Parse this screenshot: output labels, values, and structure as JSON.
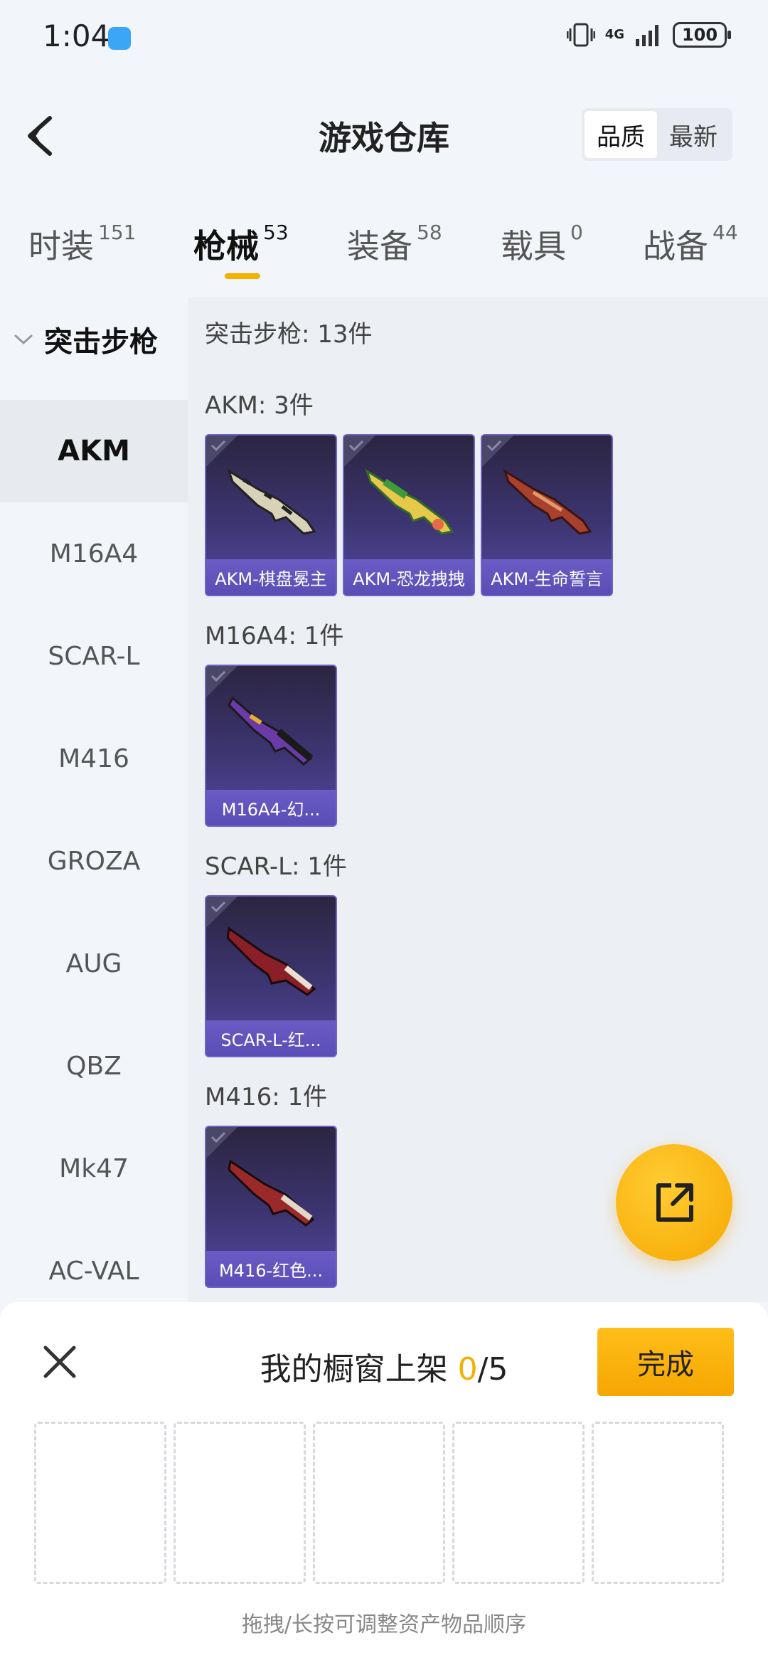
{
  "status": {
    "time": "1:04",
    "network": "4G",
    "battery": "100"
  },
  "header": {
    "title": "游戏仓库",
    "sort_options": [
      "品质",
      "最新"
    ],
    "sort_active": "品质"
  },
  "tabs": [
    {
      "label": "时装",
      "count": "151"
    },
    {
      "label": "枪械",
      "count": "53"
    },
    {
      "label": "装备",
      "count": "58"
    },
    {
      "label": "载具",
      "count": "0"
    },
    {
      "label": "战备",
      "count": "44"
    }
  ],
  "active_tab": "枪械",
  "sidebar": {
    "category": "突击步枪",
    "items": [
      "AKM",
      "M16A4",
      "SCAR-L",
      "M416",
      "GROZA",
      "AUG",
      "QBZ",
      "Mk47",
      "AC-VAL"
    ],
    "active": "AKM"
  },
  "content": {
    "summary": "突击步枪: 13件",
    "groups": [
      {
        "title": "AKM: 3件",
        "items": [
          "AKM-棋盘冕主",
          "AKM-恐龙拽拽",
          "AKM-生命誓言"
        ]
      },
      {
        "title": "M16A4: 1件",
        "items": [
          "M16A4-幻..."
        ]
      },
      {
        "title": "SCAR-L: 1件",
        "items": [
          "SCAR-L-红..."
        ]
      },
      {
        "title": "M416: 1件",
        "items": [
          "M416-红色..."
        ]
      }
    ]
  },
  "sheet": {
    "title": "我的橱窗上架",
    "count": "0",
    "total": "/5",
    "done_label": "完成",
    "hint": "拖拽/长按可调整资产物品顺序"
  },
  "icons": {
    "back": "back-arrow-icon",
    "fab": "share-external-icon",
    "close": "close-icon"
  },
  "colors": {
    "accent": "#f6b000",
    "card_purple": "#5448a0"
  }
}
